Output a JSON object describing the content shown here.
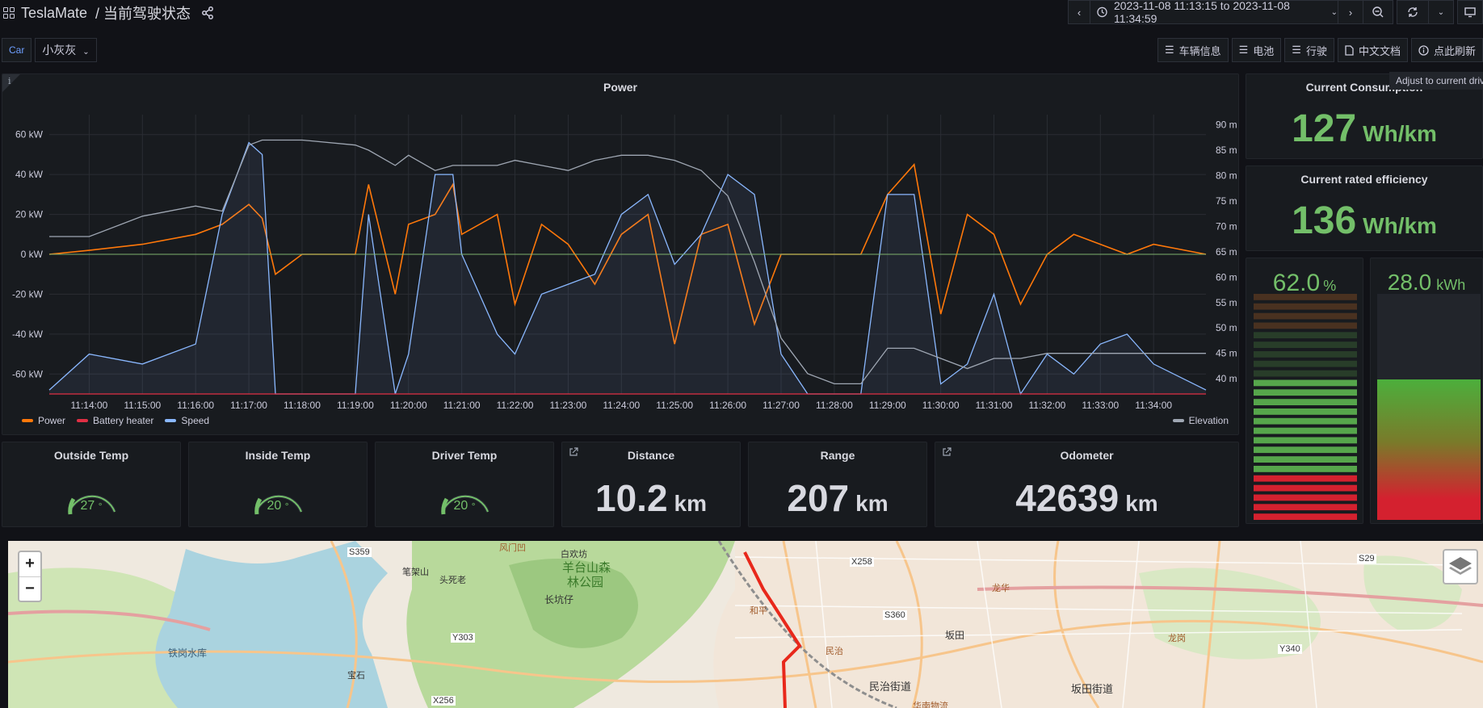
{
  "header": {
    "app_name": "TeslaMate",
    "dashboard_title": "/ 当前驾驶状态",
    "time_range": "2023-11-08 11:13:15 to 2023-11-08 11:34:59"
  },
  "variables": {
    "car_label": "Car",
    "car_value": "小灰灰"
  },
  "links": [
    {
      "label": "车辆信息",
      "icon": "bars-icon"
    },
    {
      "label": "电池",
      "icon": "bars-icon"
    },
    {
      "label": "行驶",
      "icon": "bars-icon"
    },
    {
      "label": "中文文档",
      "icon": "document-icon"
    },
    {
      "label": "点此刷新",
      "icon": "info-circle-icon"
    }
  ],
  "tooltip": "Adjust to current drive",
  "power_panel": {
    "title": "Power",
    "info_icon": "i",
    "left_ticks": [
      "60 kW",
      "40 kW",
      "20 kW",
      "0 kW",
      "-20 kW",
      "-40 kW",
      "-60 kW"
    ],
    "right_ticks": [
      "90 m",
      "85 m",
      "80 m",
      "75 m",
      "70 m",
      "65 m",
      "60 m",
      "55 m",
      "50 m",
      "45 m",
      "40 m"
    ],
    "x_ticks": [
      "11:14:00",
      "11:15:00",
      "11:16:00",
      "11:17:00",
      "11:18:00",
      "11:19:00",
      "11:20:00",
      "11:21:00",
      "11:22:00",
      "11:23:00",
      "11:24:00",
      "11:25:00",
      "11:26:00",
      "11:27:00",
      "11:28:00",
      "11:29:00",
      "11:30:00",
      "11:31:00",
      "11:32:00",
      "11:33:00",
      "11:34:00"
    ],
    "legend_left": [
      {
        "name": "Power",
        "color": "#ff780a"
      },
      {
        "name": "Battery heater",
        "color": "#e02f44"
      },
      {
        "name": "Speed",
        "color": "#8ab8ff"
      }
    ],
    "legend_right": [
      {
        "name": "Elevation",
        "color": "#9fa7b3"
      }
    ]
  },
  "chart_data": {
    "type": "line",
    "x": [
      "11:13:15",
      "11:14:00",
      "11:15:00",
      "11:16:00",
      "11:16:30",
      "11:17:00",
      "11:17:15",
      "11:17:30",
      "11:18:00",
      "11:19:00",
      "11:19:15",
      "11:19:45",
      "11:20:00",
      "11:20:30",
      "11:20:50",
      "11:21:00",
      "11:21:40",
      "11:22:00",
      "11:22:30",
      "11:23:00",
      "11:23:30",
      "11:24:00",
      "11:24:30",
      "11:25:00",
      "11:25:30",
      "11:26:00",
      "11:26:30",
      "11:27:00",
      "11:27:30",
      "11:28:00",
      "11:28:30",
      "11:29:00",
      "11:29:30",
      "11:30:00",
      "11:30:30",
      "11:31:00",
      "11:31:30",
      "11:32:00",
      "11:32:30",
      "11:33:00",
      "11:33:30",
      "11:34:00",
      "11:34:59"
    ],
    "series": [
      {
        "name": "Power",
        "axis": "kW",
        "values": [
          0,
          2,
          5,
          10,
          15,
          25,
          18,
          -10,
          0,
          0,
          35,
          -20,
          15,
          20,
          35,
          10,
          20,
          -25,
          15,
          5,
          -15,
          10,
          20,
          -45,
          10,
          15,
          -35,
          0,
          0,
          0,
          0,
          30,
          45,
          -30,
          20,
          10,
          -25,
          0,
          10,
          5,
          0,
          5,
          0
        ]
      },
      {
        "name": "Speed",
        "axis": "kW",
        "values": [
          -68,
          -50,
          -55,
          -45,
          20,
          56,
          50,
          -70,
          -70,
          -70,
          20,
          -70,
          -50,
          40,
          40,
          0,
          -40,
          -50,
          -20,
          -15,
          -10,
          20,
          30,
          -5,
          10,
          40,
          30,
          -50,
          -70,
          -70,
          -70,
          30,
          30,
          -65,
          -55,
          -20,
          -70,
          -50,
          -60,
          -45,
          -40,
          -55,
          -68
        ]
      },
      {
        "name": "Battery heater",
        "axis": "kW",
        "values": [
          -70,
          -70,
          -70,
          -70,
          -70,
          -70,
          -70,
          -70,
          -70,
          -70,
          -70,
          -70,
          -70,
          -70,
          -70,
          -70,
          -70,
          -70,
          -70,
          -70,
          -70,
          -70,
          -70,
          -70,
          -70,
          -70,
          -70,
          -70,
          -70,
          -70,
          -70,
          -70,
          -70,
          -70,
          -70,
          -70,
          -70,
          -70,
          -70,
          -70,
          -70,
          -70,
          -70
        ]
      },
      {
        "name": "Elevation",
        "axis": "m",
        "values": [
          68,
          68,
          72,
          74,
          73,
          86,
          87,
          87,
          87,
          86,
          85,
          82,
          84,
          81,
          82,
          82,
          82,
          83,
          82,
          81,
          83,
          84,
          84,
          83,
          81,
          76,
          63,
          48,
          41,
          39,
          39,
          46,
          46,
          44,
          42,
          44,
          44,
          45,
          45,
          45,
          45,
          45,
          45
        ]
      }
    ],
    "ylim_left": [
      -70,
      70
    ],
    "ylim_right": [
      37,
      92
    ],
    "grid": true
  },
  "current_consumption": {
    "title": "Current Consumption",
    "value": "127",
    "unit": "Wh/km"
  },
  "rated_efficiency": {
    "title": "Current rated efficiency",
    "value": "136",
    "unit": "Wh/km"
  },
  "soc_gauge": {
    "value": "62.0",
    "unit": "%",
    "level": 0.62
  },
  "energy_gauge": {
    "value": "28.0",
    "unit": "kWh",
    "level": 0.62
  },
  "temps": [
    {
      "title": "Outside Temp",
      "value": "27",
      "unit": "°"
    },
    {
      "title": "Inside Temp",
      "value": "20",
      "unit": "°"
    },
    {
      "title": "Driver Temp",
      "value": "20",
      "unit": "°"
    }
  ],
  "distance": {
    "title": "Distance",
    "value": "10.2",
    "unit": "km"
  },
  "range": {
    "title": "Range",
    "value": "207",
    "unit": "km"
  },
  "odometer": {
    "title": "Odometer",
    "value": "42639",
    "unit": "km"
  },
  "map": {
    "zoom_in": "+",
    "zoom_out": "−",
    "labels": [
      "S359",
      "X258",
      "S360",
      "S29",
      "Y303",
      "Y340",
      "X256",
      "羊台山森",
      "林公园",
      "长坑仔",
      "铁岗水库",
      "民治街道",
      "坂田街道",
      "坂田",
      "宝石",
      "笔架山",
      "头死老",
      "白欢坊",
      "风门凹",
      "和平",
      "龙华",
      "民治",
      "华南物流",
      "龙岗"
    ]
  }
}
